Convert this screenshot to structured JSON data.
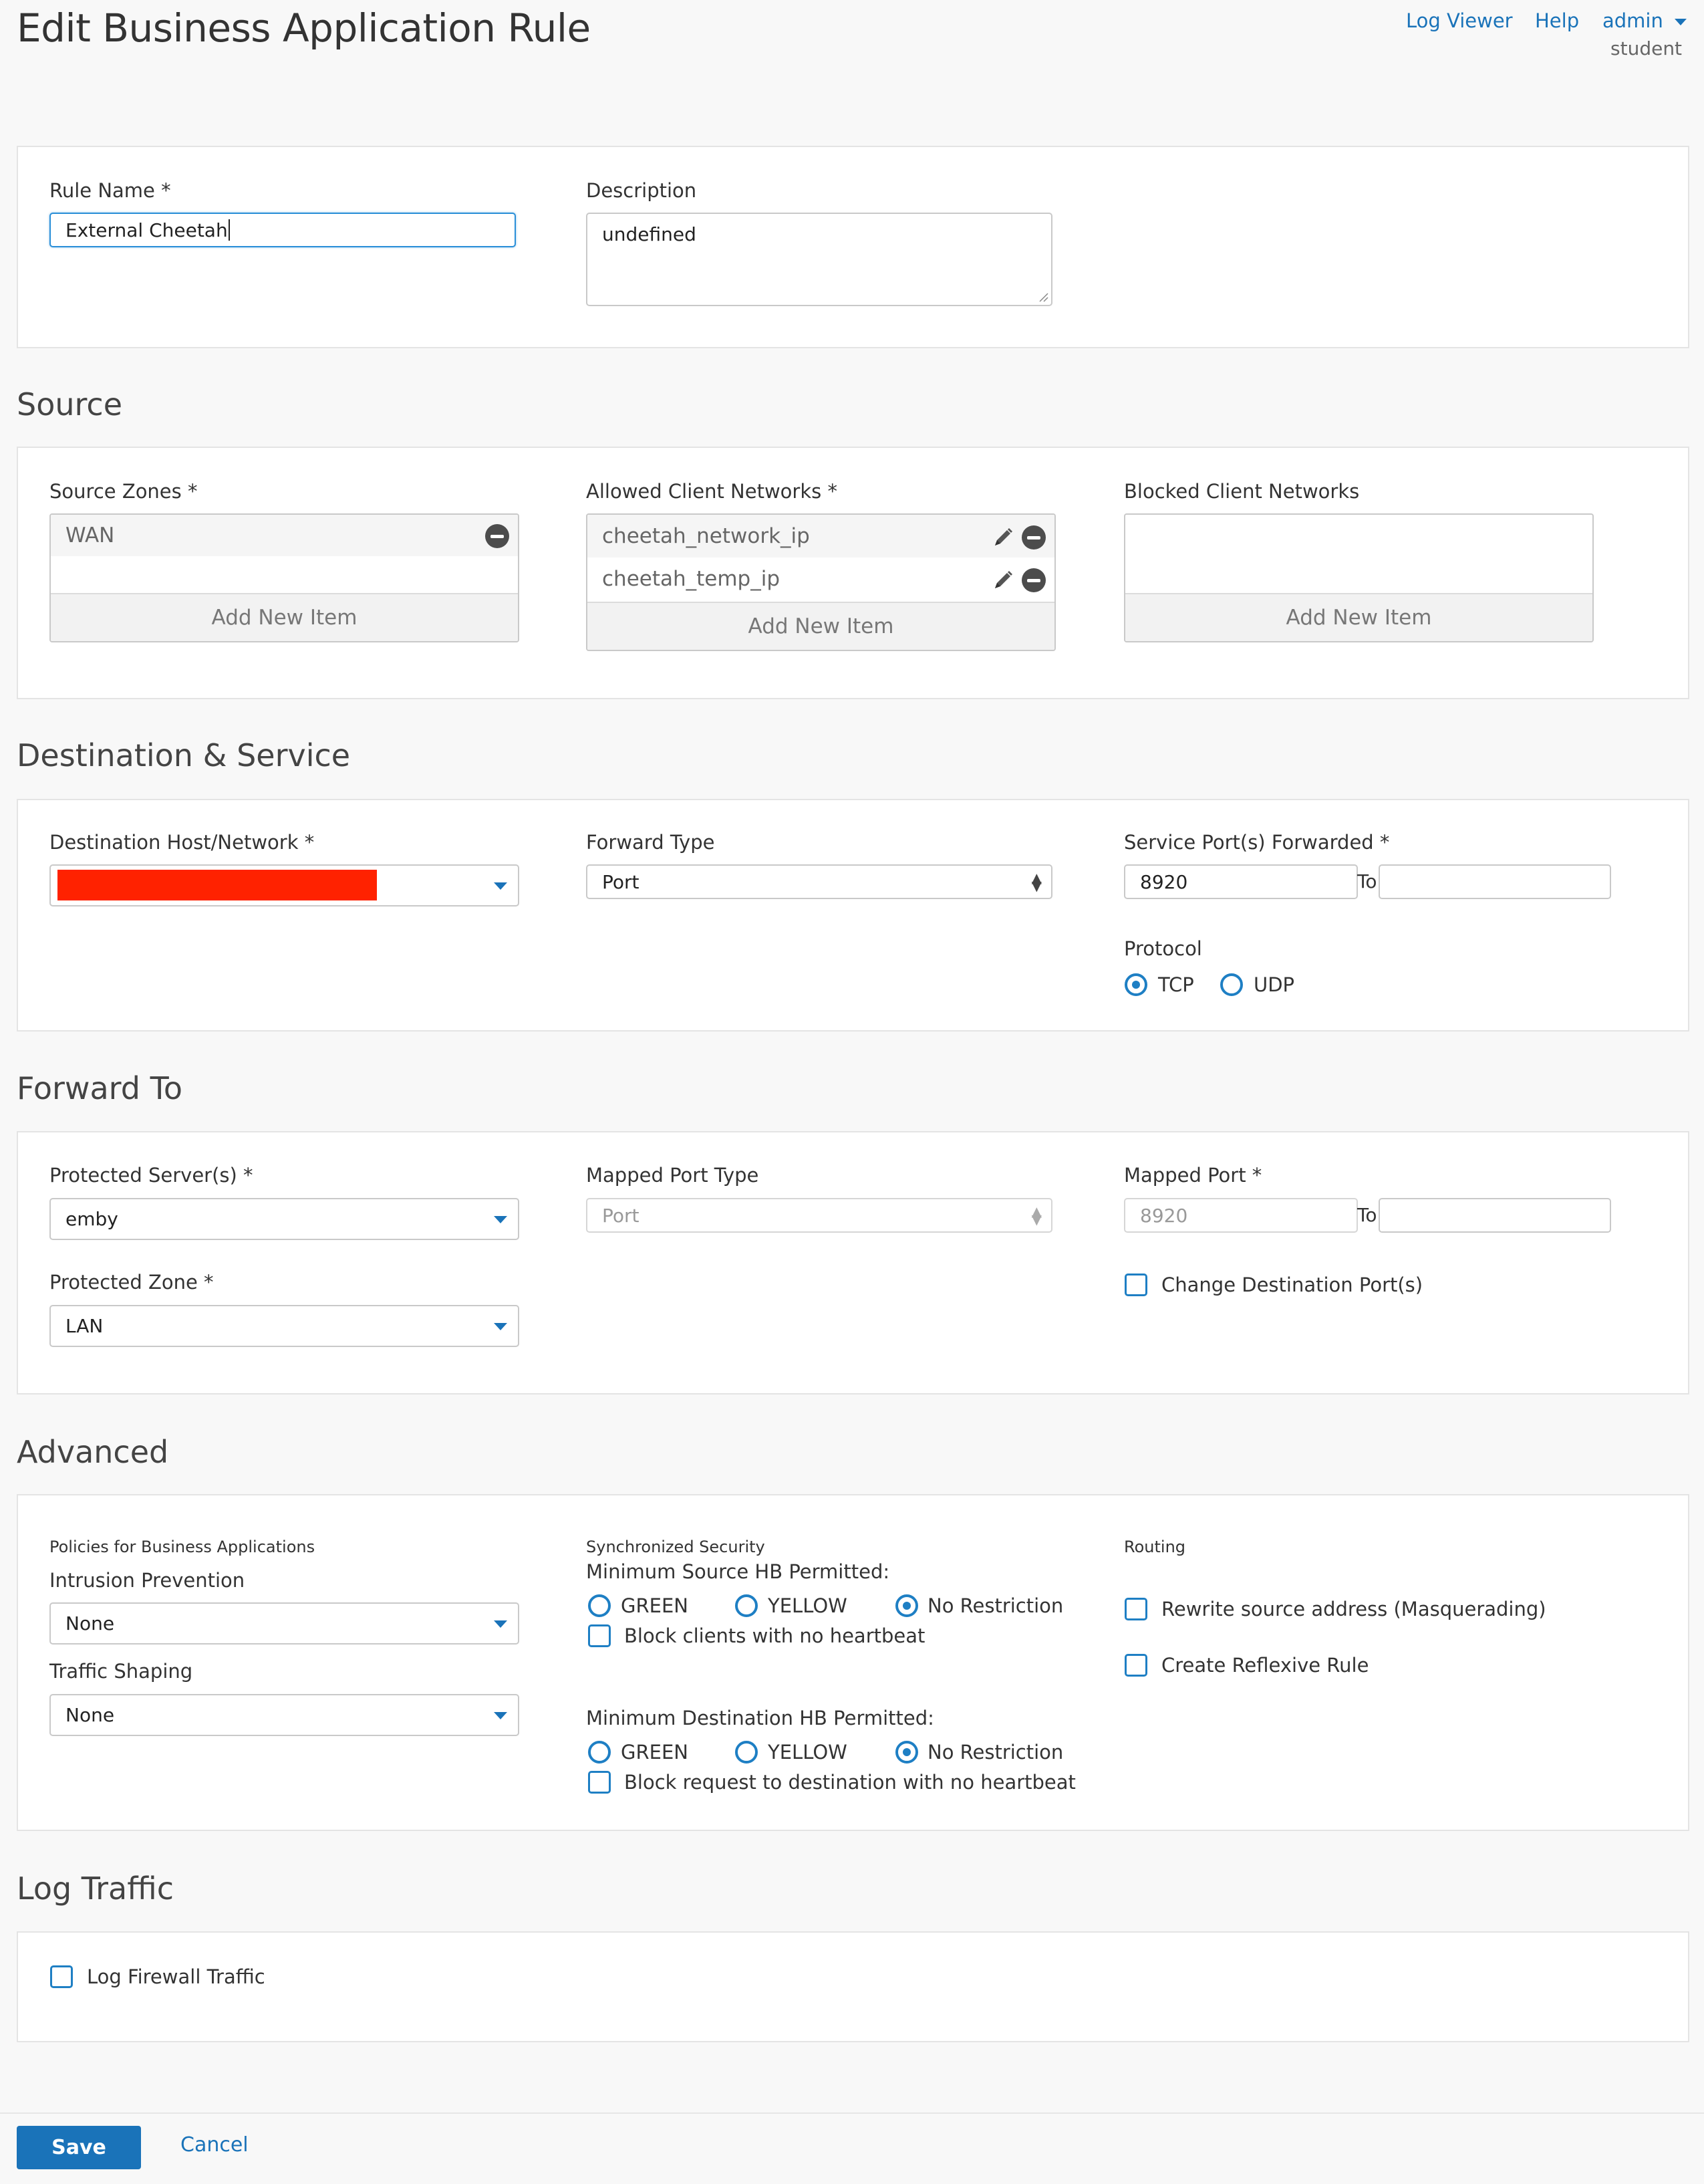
{
  "header": {
    "title": "Edit Business Application Rule",
    "log_viewer": "Log Viewer",
    "help": "Help",
    "user": "admin",
    "user_sub": "student"
  },
  "general": {
    "rule_name_label": "Rule Name *",
    "rule_name_value": "External Cheetah",
    "description_label": "Description",
    "description_value": "undefined"
  },
  "source": {
    "title": "Source",
    "zones_label": "Source Zones *",
    "zones": [
      "WAN"
    ],
    "allowed_label": "Allowed Client Networks *",
    "allowed": [
      "cheetah_network_ip",
      "cheetah_temp_ip"
    ],
    "blocked_label": "Blocked Client Networks",
    "add_new": "Add New Item"
  },
  "destination": {
    "title": "Destination & Service",
    "host_label": "Destination Host/Network *",
    "forward_type_label": "Forward Type",
    "forward_type_value": "Port",
    "service_ports_label": "Service Port(s) Forwarded *",
    "service_port_from": "8920",
    "service_port_to": "",
    "to_label": "To",
    "protocol_label": "Protocol",
    "protocol_tcp": "TCP",
    "protocol_udp": "UDP",
    "protocol_selected": "TCP"
  },
  "forward_to": {
    "title": "Forward To",
    "protected_servers_label": "Protected Server(s) *",
    "protected_servers_value": "emby",
    "protected_zone_label": "Protected Zone *",
    "protected_zone_value": "LAN",
    "mapped_port_type_label": "Mapped Port Type",
    "mapped_port_type_value": "Port",
    "mapped_port_label": "Mapped Port *",
    "mapped_port_from": "8920",
    "mapped_port_to": "",
    "to_label": "To",
    "change_dest_label": "Change Destination Port(s)"
  },
  "advanced": {
    "title": "Advanced",
    "policies_label": "Policies for Business Applications",
    "ips_label": "Intrusion Prevention",
    "ips_value": "None",
    "shaping_label": "Traffic Shaping",
    "shaping_value": "None",
    "sync_label": "Synchronized Security",
    "min_source_label": "Minimum Source HB Permitted:",
    "green": "GREEN",
    "yellow": "YELLOW",
    "no_restriction": "No Restriction",
    "block_clients_label": "Block clients with no heartbeat",
    "min_dest_label": "Minimum Destination HB Permitted:",
    "block_dest_label": "Block request to destination with no heartbeat",
    "routing_label": "Routing",
    "masquerade_label": "Rewrite source address (Masquerading)",
    "reflexive_label": "Create Reflexive Rule"
  },
  "log": {
    "title": "Log Traffic",
    "log_fw_label": "Log Firewall Traffic"
  },
  "footer": {
    "save": "Save",
    "cancel": "Cancel"
  },
  "colors": {
    "accent": "#1a73b9",
    "radio": "#1e7fc4",
    "redacted": "#ff2200"
  }
}
